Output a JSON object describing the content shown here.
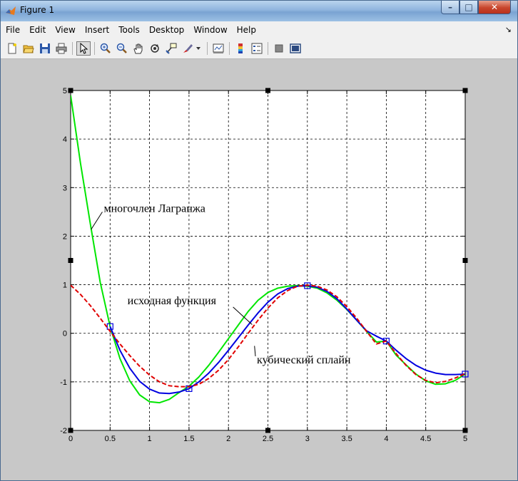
{
  "window": {
    "title": "Figure 1"
  },
  "caption_buttons": {
    "minimize": "–",
    "maximize": "□",
    "close": "✕"
  },
  "menu": {
    "items": [
      {
        "label": "File"
      },
      {
        "label": "Edit"
      },
      {
        "label": "View"
      },
      {
        "label": "Insert"
      },
      {
        "label": "Tools"
      },
      {
        "label": "Desktop"
      },
      {
        "label": "Window"
      },
      {
        "label": "Help"
      }
    ],
    "dock_arrow": "↘"
  },
  "toolbar": {
    "buttons": [
      {
        "name": "new-figure-icon"
      },
      {
        "name": "open-file-icon"
      },
      {
        "name": "save-icon"
      },
      {
        "name": "print-icon"
      },
      {
        "name": "edit-plot-icon",
        "active": true
      },
      {
        "name": "zoom-in-icon"
      },
      {
        "name": "zoom-out-icon"
      },
      {
        "name": "pan-hand-icon"
      },
      {
        "name": "rotate-3d-icon"
      },
      {
        "name": "data-cursor-icon"
      },
      {
        "name": "brush-icon"
      },
      {
        "name": "link-plot-icon"
      },
      {
        "name": "insert-colorbar-icon"
      },
      {
        "name": "insert-legend-icon"
      },
      {
        "name": "hide-plot-tools-icon"
      },
      {
        "name": "show-plot-tools-icon"
      }
    ]
  },
  "chart_data": {
    "type": "line",
    "title": "",
    "xlabel": "",
    "ylabel": "",
    "xlim": [
      0,
      5
    ],
    "ylim": [
      -2,
      5
    ],
    "xticks": [
      "0",
      "0.5",
      "1",
      "1.5",
      "2",
      "2.5",
      "3",
      "3.5",
      "4",
      "4.5",
      "5"
    ],
    "yticks": [
      "-2",
      "-1",
      "0",
      "1",
      "2",
      "3",
      "4",
      "5"
    ],
    "grid": "dashed",
    "series": [
      {
        "color": "#00e600",
        "style": "solid",
        "x": [
          0,
          0.125,
          0.25,
          0.375,
          0.5,
          0.625,
          0.75,
          0.875,
          1,
          1.125,
          1.25,
          1.375,
          1.5,
          1.625,
          1.75,
          1.875,
          2,
          2.125,
          2.25,
          2.375,
          2.5,
          2.625,
          2.75,
          2.875,
          3,
          3.125,
          3.25,
          3.375,
          3.5,
          3.625,
          3.75,
          3.875,
          4,
          4.125,
          4.25,
          4.375,
          4.5,
          4.625,
          4.75,
          4.875,
          5
        ],
        "y": [
          4.9,
          3.5,
          2.25,
          1.05,
          0.14,
          -0.52,
          -0.98,
          -1.27,
          -1.41,
          -1.43,
          -1.36,
          -1.22,
          -1.09,
          -0.9,
          -0.66,
          -0.39,
          -0.11,
          0.17,
          0.45,
          0.68,
          0.84,
          0.93,
          0.97,
          0.98,
          0.97,
          0.93,
          0.83,
          0.68,
          0.49,
          0.27,
          0.04,
          -0.18,
          -0.16,
          -0.45,
          -0.65,
          -0.84,
          -0.98,
          -1.05,
          -1.04,
          -0.97,
          -0.84
        ]
      },
      {
        "color": "#0000e0",
        "style": "solid",
        "x": [
          0.5,
          0.625,
          0.75,
          0.875,
          1,
          1.125,
          1.25,
          1.375,
          1.5,
          1.625,
          1.75,
          1.875,
          2,
          2.125,
          2.25,
          2.375,
          2.5,
          2.625,
          2.75,
          2.875,
          3,
          3.125,
          3.25,
          3.375,
          3.5,
          3.625,
          3.75,
          3.875,
          4,
          4.125,
          4.25,
          4.375,
          4.5,
          4.625,
          4.75,
          4.875,
          5
        ],
        "y": [
          0.14,
          -0.35,
          -0.72,
          -0.99,
          -1.15,
          -1.23,
          -1.24,
          -1.21,
          -1.14,
          -1.0,
          -0.82,
          -0.6,
          -0.35,
          -0.09,
          0.17,
          0.42,
          0.64,
          0.81,
          0.92,
          0.97,
          0.98,
          0.95,
          0.86,
          0.71,
          0.5,
          0.27,
          0.05,
          -0.06,
          -0.16,
          -0.35,
          -0.52,
          -0.66,
          -0.76,
          -0.82,
          -0.85,
          -0.85,
          -0.84
        ],
        "markers": {
          "x": [
            0.5,
            1.5,
            3,
            4,
            5
          ],
          "y": [
            0.14,
            -1.14,
            0.98,
            -0.16,
            -0.84
          ],
          "shape": "square"
        }
      },
      {
        "color": "#e00000",
        "style": "dashed",
        "x": [
          0,
          0.125,
          0.25,
          0.375,
          0.5,
          0.625,
          0.75,
          0.875,
          1,
          1.125,
          1.25,
          1.375,
          1.5,
          1.625,
          1.75,
          1.875,
          2,
          2.125,
          2.25,
          2.375,
          2.5,
          2.625,
          2.75,
          2.875,
          3,
          3.125,
          3.25,
          3.375,
          3.5,
          3.625,
          3.75,
          3.875,
          4,
          4.125,
          4.25,
          4.375,
          4.5,
          4.625,
          4.75,
          4.875,
          5
        ],
        "y": [
          0.99,
          0.8,
          0.57,
          0.31,
          0.04,
          -0.22,
          -0.46,
          -0.68,
          -0.86,
          -1.0,
          -1.08,
          -1.1,
          -1.1,
          -1.05,
          -0.93,
          -0.76,
          -0.54,
          -0.28,
          0.0,
          0.27,
          0.52,
          0.73,
          0.88,
          0.97,
          0.99,
          0.97,
          0.89,
          0.75,
          0.55,
          0.31,
          0.04,
          -0.22,
          -0.16,
          -0.42,
          -0.66,
          -0.85,
          -0.97,
          -1.02,
          -0.99,
          -0.92,
          -0.83
        ]
      }
    ],
    "annotations": [
      {
        "text": "многочлен Лагранжа",
        "x": 0.42,
        "y": 2.5,
        "arrow_to": [
          0.26,
          2.14
        ]
      },
      {
        "text": "исходная функция",
        "x": 0.72,
        "y": 0.6,
        "arrow_to": [
          2.3,
          0.18
        ]
      },
      {
        "text": "кубический сплайн",
        "x": 2.36,
        "y": -0.62,
        "arrow_to": [
          2.33,
          -0.26
        ]
      }
    ]
  }
}
